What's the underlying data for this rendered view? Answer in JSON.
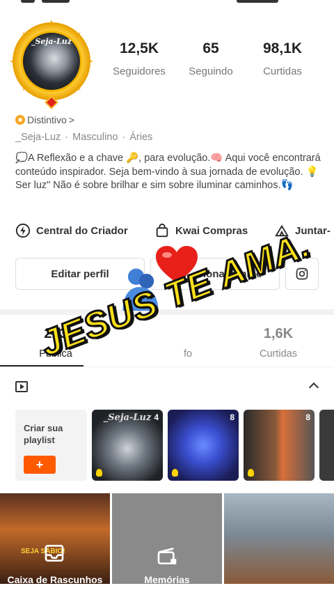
{
  "profile": {
    "avatar_text": "_Seja-Luz",
    "stats": [
      {
        "value": "12,5K",
        "label": "Seguidores"
      },
      {
        "value": "65",
        "label": "Seguindo"
      },
      {
        "value": "98,1K",
        "label": "Curtidas"
      }
    ],
    "badge_label": "Distintivo",
    "badge_chevron": ">",
    "meta": [
      "_Seja-Luz",
      "Masculino",
      "Áries"
    ],
    "bio": "💭A Reflexão e a chave 🔑, para evolução.🧠 Aqui você encontrará conteúdo inspirador. Seja bem-vindo à sua jornada de evolução. 💡 Ser luz\" Não é sobre brilhar e sim sobre iluminar caminhos.👣"
  },
  "tools": [
    {
      "label": "Central do Criador",
      "icon": "bolt-circle-icon"
    },
    {
      "label": "Kwai Compras",
      "icon": "shopping-bag-icon"
    },
    {
      "label": "Juntar-",
      "icon": "tent-icon"
    }
  ],
  "buttons": {
    "edit_profile": "Editar perfil",
    "add_friends": "cionar amigo"
  },
  "content_tabs": [
    {
      "value": "213",
      "label": "Publica"
    },
    {
      "value": "",
      "label": "fo"
    },
    {
      "value": "1,6K",
      "label": "Curtidas"
    }
  ],
  "playlists": {
    "create_label": "Criar sua playlist",
    "create_button": "+",
    "items": [
      {
        "count": "4",
        "caption": "_Seja-Luz"
      },
      {
        "count": "8",
        "caption": ""
      },
      {
        "count": "8",
        "caption": ""
      }
    ]
  },
  "grid": [
    {
      "label": "Caixa de Rascunhos",
      "sign": "SEJA SÁBIO!"
    },
    {
      "label": "Memórias"
    },
    {
      "label": ""
    }
  ],
  "overlay": {
    "text": "JESUS TE AMA.",
    "heart": "red-heart-icon",
    "hug": "people-hugging-icon"
  },
  "colors": {
    "accent": "#ff5a00",
    "overlay_yellow": "#ffe11a",
    "badge_orange": "#f5a623"
  }
}
